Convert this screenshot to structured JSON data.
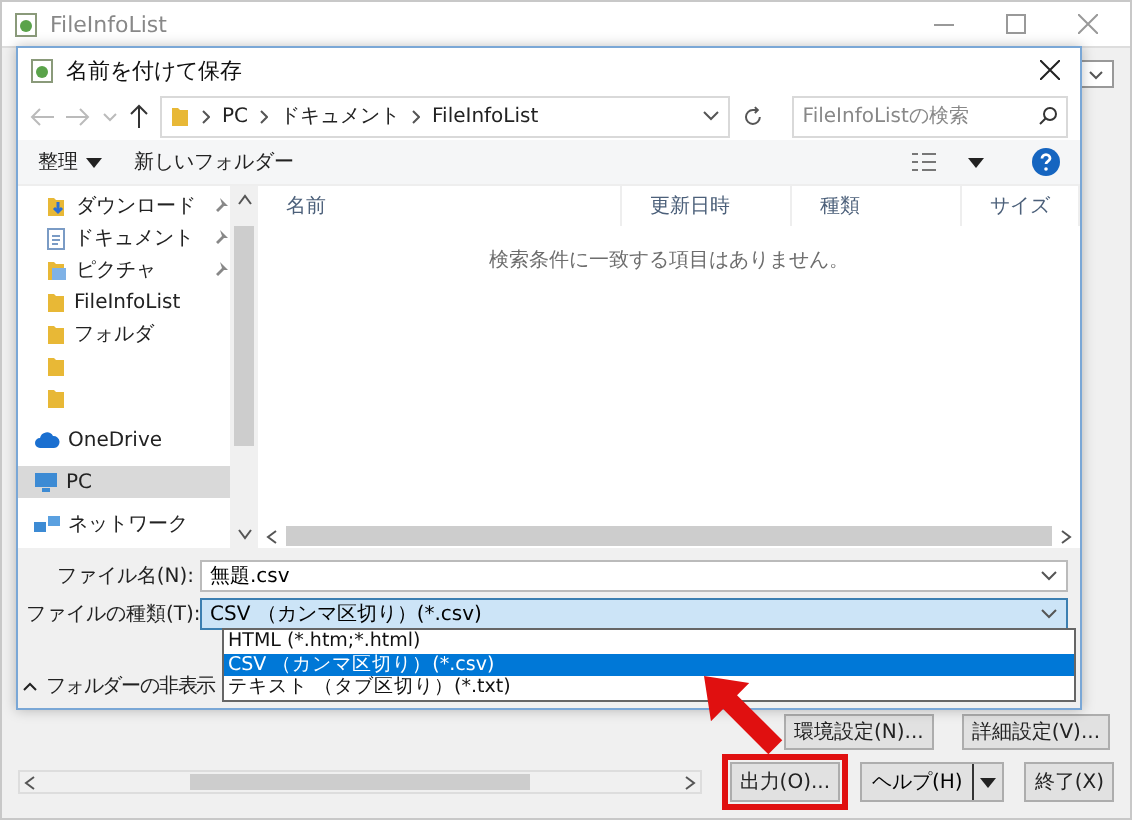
{
  "window": {
    "title": "FileInfoList"
  },
  "dialog": {
    "title": "名前を付けて保存",
    "breadcrumb": [
      "PC",
      "ドキュメント",
      "FileInfoList"
    ],
    "search": {
      "placeholder": "FileInfoListの検索"
    },
    "toolbar": {
      "organize": "整理",
      "new_folder": "新しいフォルダー"
    },
    "nav_items": [
      {
        "label": "ダウンロード",
        "kind": "download",
        "pinned": true,
        "selected": false
      },
      {
        "label": "ドキュメント",
        "kind": "document",
        "pinned": true,
        "selected": false
      },
      {
        "label": "ピクチャ",
        "kind": "picture",
        "pinned": true,
        "selected": false
      },
      {
        "label": "FileInfoList",
        "kind": "folder",
        "pinned": false,
        "selected": false
      },
      {
        "label": "フォルダ",
        "kind": "folder",
        "pinned": false,
        "selected": false
      },
      {
        "kind": "folder",
        "pinned": false,
        "selected": false
      },
      {
        "kind": "folder",
        "pinned": false,
        "selected": false
      },
      {
        "label": "OneDrive",
        "kind": "cloud",
        "pinned": false,
        "selected": false
      },
      {
        "label": "PC",
        "kind": "pc",
        "pinned": false,
        "selected": true
      },
      {
        "label": "ネットワーク",
        "kind": "network",
        "pinned": false,
        "selected": false
      }
    ],
    "columns": [
      "名前",
      "更新日時",
      "種類",
      "サイズ"
    ],
    "empty_message": "検索条件に一致する項目はありません。",
    "file_name": {
      "label": "ファイル名(N):",
      "value": "無題.csv"
    },
    "file_type": {
      "label": "ファイルの種類(T):",
      "value": "CSV （カンマ区切り）(*.csv)",
      "options": [
        {
          "label": "HTML (*.htm;*.html)",
          "selected": false
        },
        {
          "label": "CSV （カンマ区切り）(*.csv)",
          "selected": true
        },
        {
          "label": "テキスト （タブ区切り）(*.txt)",
          "selected": false
        }
      ]
    },
    "hide_folders": "フォルダーの非表示"
  },
  "settings_buttons": [
    "環境設定(N)...",
    "詳細設定(V)..."
  ],
  "buttons": [
    {
      "label": "出力(O)...",
      "kind": "plain",
      "highlighted": true
    },
    {
      "label": "ヘルプ(H)",
      "kind": "split",
      "highlighted": false
    },
    {
      "label": "終了(X)",
      "kind": "plain",
      "highlighted": false
    }
  ]
}
